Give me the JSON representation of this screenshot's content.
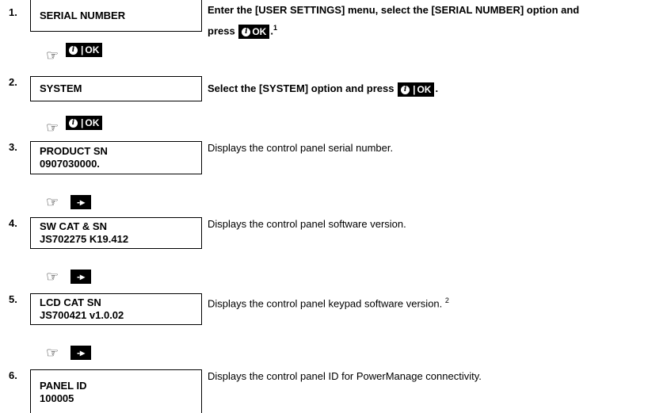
{
  "steps": [
    {
      "num": "1.",
      "box_line1": "SERIAL NUMBER",
      "box_line2": "",
      "desc_line1": "Enter the [USER SETTINGS] menu, select the [SERIAL NUMBER] option and",
      "desc_line2_pre": "press",
      "desc_sup": "1",
      "next_key": "ok"
    },
    {
      "num": "2.",
      "box_line1": "SYSTEM",
      "box_line2": "",
      "desc_line1": "Select the [SYSTEM] option and press",
      "next_key": "ok"
    },
    {
      "num": "3.",
      "box_line1": "PRODUCT SN",
      "box_line2": "0907030000.",
      "desc_line1": "Displays the control panel serial number.",
      "next_key": "arrow"
    },
    {
      "num": "4.",
      "box_line1": "SW CAT & SN",
      "box_line2": "JS702275 K19.412",
      "desc_line1": "Displays the control panel software version.",
      "next_key": "arrow"
    },
    {
      "num": "5.",
      "box_line1": "LCD CAT SN",
      "box_line2": "JS700421 v1.0.02",
      "desc_line1": "Displays the control panel keypad software version.",
      "desc_sup": "2",
      "next_key": "arrow"
    },
    {
      "num": "6.",
      "box_line1": "PANEL ID",
      "box_line2": "100005",
      "desc_line1": "Displays the control panel ID for PowerManage connectivity."
    }
  ],
  "keys": {
    "info_glyph": "i",
    "ok_label": "OK",
    "arrow_label": "-▸",
    "bar": "|"
  },
  "icons": {
    "hand": "pointing-hand-icon"
  }
}
